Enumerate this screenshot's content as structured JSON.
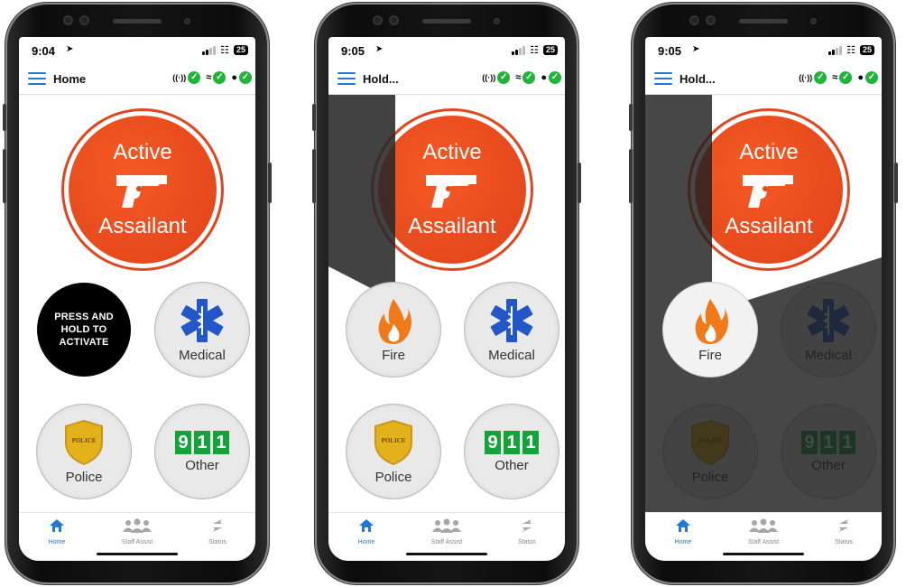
{
  "phones": [
    {
      "status_time": "9:04",
      "battery": "25",
      "app_title": "Home",
      "hold_button_text": "PRESS AND HOLD TO ACTIVATE"
    },
    {
      "status_time": "9:05",
      "battery": "25",
      "app_title": "Hold..."
    },
    {
      "status_time": "9:05",
      "battery": "25",
      "app_title": "Hold..."
    }
  ],
  "active_assailant": {
    "line1": "Active",
    "line2": "Assailant"
  },
  "buttons": {
    "fire": "Fire",
    "medical": "Medical",
    "police": "Police",
    "other": "Other",
    "nine_one_one": [
      "9",
      "1",
      "1"
    ],
    "police_badge_text": "POLICE"
  },
  "tabs": {
    "home": "Home",
    "staff_assist": "Staff Assist",
    "status": "Status"
  },
  "colors": {
    "accent_blue": "#1f79d8",
    "alert_orange": "#e9461c",
    "ok_green": "#1fb53a",
    "emergency_green": "#12a33a",
    "shield_gold": "#e3b21a",
    "star_blue": "#2357c9"
  }
}
